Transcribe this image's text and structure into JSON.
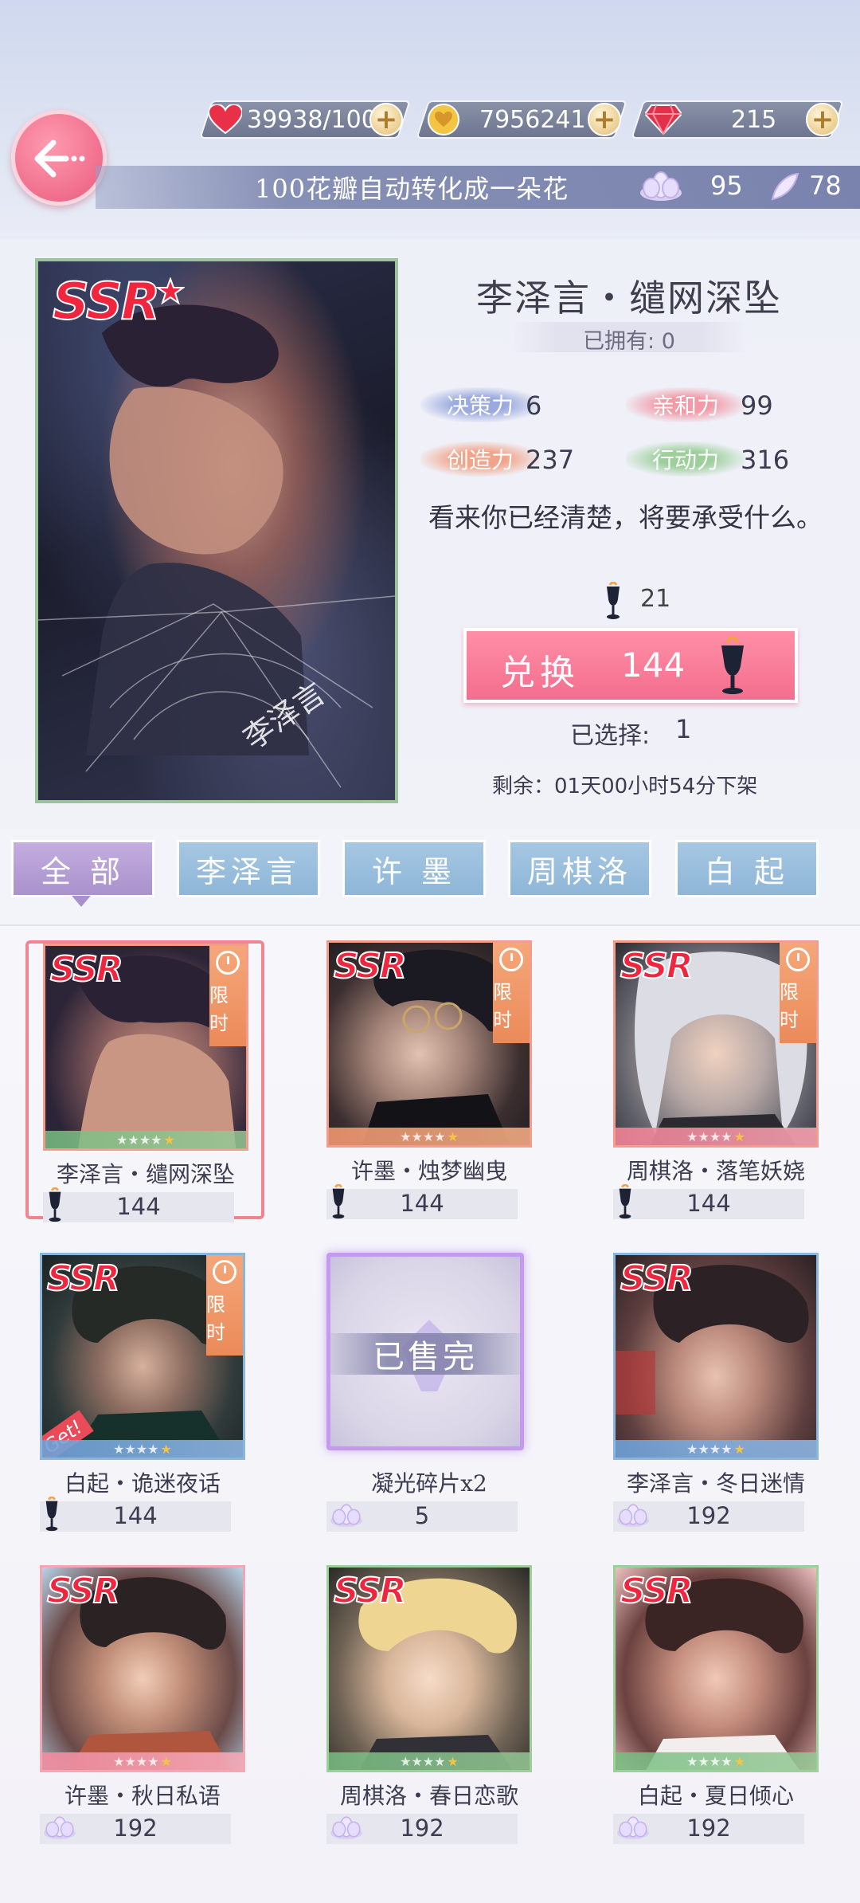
{
  "resources": {
    "stamina": "39938/100",
    "gold": "7956241",
    "diamond": "215"
  },
  "banner": {
    "text": "100花瓣自动转化成一朵花",
    "flower_count": "95",
    "petal_count": "78"
  },
  "detail": {
    "title": "李泽言・缱网深坠",
    "owned": "已拥有: 0",
    "stats": [
      {
        "label": "决策力",
        "value": "6",
        "color": "#9aa9de"
      },
      {
        "label": "亲和力",
        "value": "99",
        "color": "#f29aa7"
      },
      {
        "label": "创造力",
        "value": "237",
        "color": "#f2a48a"
      },
      {
        "label": "行动力",
        "value": "316",
        "color": "#9ccf9a"
      }
    ],
    "quote": "看来你已经清楚，将要承受什么。",
    "currency_owned": "21",
    "exchange_label": "兑换",
    "exchange_price": "144",
    "selected_label": "已选择:",
    "selected_value": "1",
    "remaining": "剩余：01天00小时54分下架",
    "card_ssr": "SSR",
    "card_signature": "李泽言"
  },
  "tabs": [
    {
      "label": "全 部",
      "active": true
    },
    {
      "label": "李泽言",
      "active": false
    },
    {
      "label": "许 墨",
      "active": false
    },
    {
      "label": "周棋洛",
      "active": false
    },
    {
      "label": "白 起",
      "active": false
    }
  ],
  "items": [
    {
      "name": "李泽言・缱网深坠",
      "price": "144",
      "currency": "goblet-icon",
      "ssr": "SSR",
      "limited": "限时",
      "selected": true
    },
    {
      "name": "许墨・烛梦幽曳",
      "price": "144",
      "currency": "goblet-icon",
      "ssr": "SSR",
      "limited": "限时"
    },
    {
      "name": "周棋洛・落笔妖娆",
      "price": "144",
      "currency": "goblet-icon",
      "ssr": "SSR",
      "limited": "限时"
    },
    {
      "name": "白起・诡迷夜话",
      "price": "144",
      "currency": "goblet-icon",
      "ssr": "SSR",
      "limited": "限时",
      "get": "Get!"
    },
    {
      "name": "凝光碎片x2",
      "price": "5",
      "currency": "flower-icon",
      "soldout": "已售完"
    },
    {
      "name": "李泽言・冬日迷情",
      "price": "192",
      "currency": "flower-icon",
      "ssr": "SSR"
    },
    {
      "name": "许墨・秋日私语",
      "price": "192",
      "currency": "flower-icon",
      "ssr": "SSR"
    },
    {
      "name": "周棋洛・春日恋歌",
      "price": "192",
      "currency": "flower-icon",
      "ssr": "SSR"
    },
    {
      "name": "白起・夏日倾心",
      "price": "192",
      "currency": "flower-icon",
      "ssr": "SSR"
    }
  ]
}
